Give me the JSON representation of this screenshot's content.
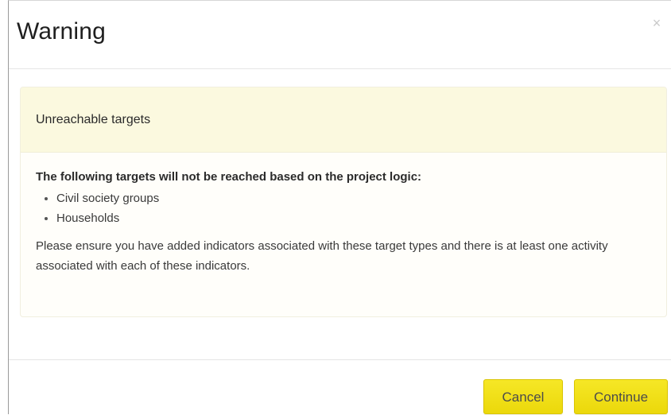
{
  "dialog": {
    "title": "Warning",
    "close_glyph": "×"
  },
  "panel": {
    "heading": "Unreachable targets",
    "lead": "The following targets will not be reached based on the project logic:",
    "items": [
      "Civil society groups",
      "Households"
    ],
    "note": "Please ensure you have added indicators associated with these target types and there is at least one activity associated with each of these indicators."
  },
  "footer": {
    "cancel_label": "Cancel",
    "continue_label": "Continue"
  },
  "colors": {
    "button_accent": "#ebd80b",
    "panel_heading_bg": "#fbf9df"
  },
  "icons": {
    "close": "close-icon"
  }
}
